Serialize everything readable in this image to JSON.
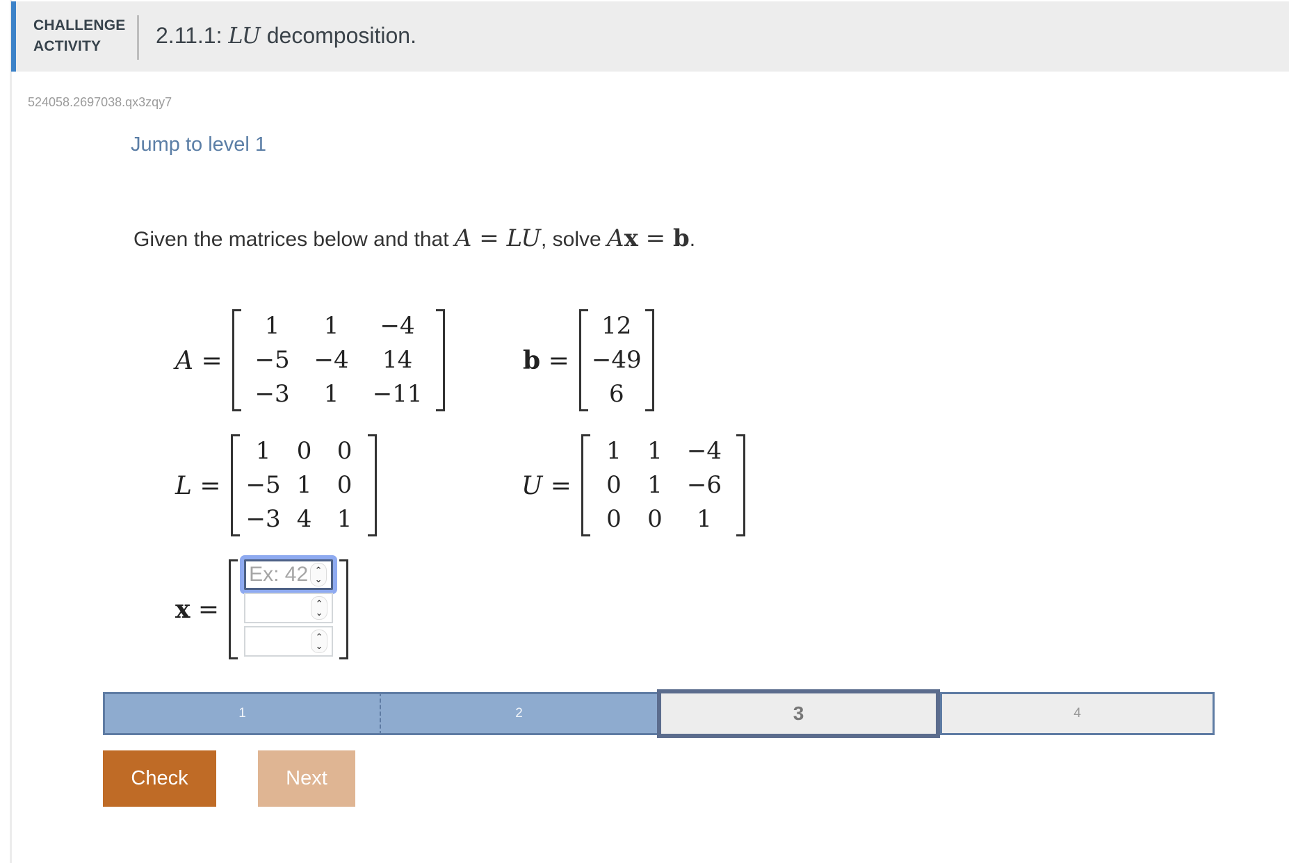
{
  "header": {
    "kind_line1": "CHALLENGE",
    "kind_line2": "ACTIVITY",
    "title_prefix": "2.11.1: ",
    "title_math": "LU",
    "title_suffix": " decomposition.",
    "accent_color": "#3c82c8"
  },
  "activity_id": "524058.2697038.qx3zqy7",
  "jump_link": "Jump to level 1",
  "prompt": {
    "text1": "Given the matrices below and that ",
    "math1_A": "A",
    "math1_eq": " = ",
    "math1_LU": "LU",
    "text2": ", solve ",
    "math2_A": "A",
    "math2_x": "x",
    "math2_eq": " = ",
    "math2_b": "b",
    "text3": "."
  },
  "matrices": {
    "A": {
      "label": "A",
      "eq": " =",
      "cells": [
        "1",
        "1",
        "−4",
        "−5",
        "−4",
        "14",
        "−3",
        "1",
        "−11"
      ]
    },
    "b": {
      "label": "b",
      "eq": " =",
      "cells": [
        "12",
        "−49",
        "6"
      ]
    },
    "L": {
      "label": "L",
      "eq": " =",
      "cells": [
        "1",
        "0",
        "0",
        "−5",
        "1",
        "0",
        "−3",
        "4",
        "1"
      ]
    },
    "U": {
      "label": "U",
      "eq": " =",
      "cells": [
        "1",
        "1",
        "−4",
        "0",
        "1",
        "−6",
        "0",
        "0",
        "1"
      ]
    }
  },
  "answer": {
    "label": "x",
    "eq": " =",
    "inputs": [
      {
        "value": "",
        "placeholder": "Ex: 42",
        "focused": true
      },
      {
        "value": "",
        "placeholder": "",
        "focused": false
      },
      {
        "value": "",
        "placeholder": "",
        "focused": false
      }
    ]
  },
  "progress": {
    "levels": [
      {
        "label": "1",
        "state": "completed"
      },
      {
        "label": "2",
        "state": "completed"
      },
      {
        "label": "3",
        "state": "current"
      },
      {
        "label": "4",
        "state": "locked"
      }
    ]
  },
  "buttons": {
    "check": "Check",
    "next": "Next"
  },
  "colors": {
    "completed": "#8eabcf",
    "current_border": "#5b6c8d",
    "check": "#bf6b26",
    "next_disabled": "#dfb593",
    "link": "#5b7ea6",
    "focus_ring": "#8eaaf0"
  }
}
